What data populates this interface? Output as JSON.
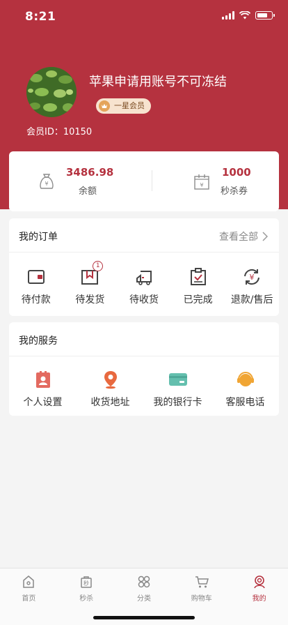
{
  "status_bar": {
    "time": "8:21"
  },
  "profile": {
    "username": "苹果申请用账号不可冻结",
    "member_level": "一星会员",
    "member_id": "会员ID：10150"
  },
  "balance": {
    "amount": "3486.98",
    "amount_label": "余额",
    "coupons": "1000",
    "coupons_label": "秒杀券"
  },
  "orders": {
    "title": "我的订单",
    "view_all": "查看全部",
    "items": [
      {
        "label": "待付款",
        "icon": "wallet-icon"
      },
      {
        "label": "待发货",
        "icon": "package-icon",
        "badge": "1"
      },
      {
        "label": "待收货",
        "icon": "truck-icon"
      },
      {
        "label": "已完成",
        "icon": "clipboard-check-icon"
      },
      {
        "label": "退款/售后",
        "icon": "refund-icon"
      }
    ]
  },
  "services": {
    "title": "我的服务",
    "items": [
      {
        "label": "个人设置",
        "icon": "person-card-icon",
        "color": "#e36a60"
      },
      {
        "label": "收货地址",
        "icon": "location-pin-icon",
        "color": "#e8693f"
      },
      {
        "label": "我的银行卡",
        "icon": "bank-card-icon",
        "color": "#64bfae"
      },
      {
        "label": "客服电话",
        "icon": "headset-icon",
        "color": "#f0a534"
      }
    ]
  },
  "tabbar": {
    "items": [
      {
        "label": "首页",
        "icon": "home-icon"
      },
      {
        "label": "秒杀",
        "icon": "flash-sale-icon"
      },
      {
        "label": "分类",
        "icon": "category-icon"
      },
      {
        "label": "购物车",
        "icon": "cart-icon"
      },
      {
        "label": "我的",
        "icon": "profile-icon",
        "active": true
      }
    ]
  },
  "colors": {
    "brand": "#b5323f",
    "background": "#f4f4f4"
  }
}
